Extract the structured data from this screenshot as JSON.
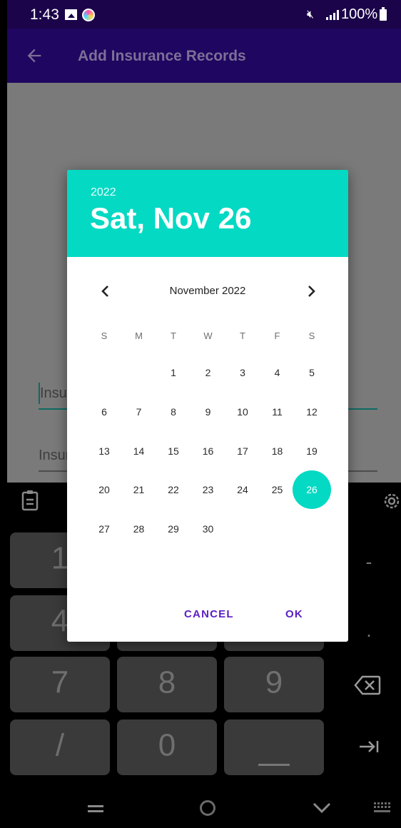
{
  "status_bar": {
    "time": "1:43",
    "battery_text": "100%"
  },
  "app_bar": {
    "title": "Add Insurance Records",
    "back_icon": "arrow-left-icon"
  },
  "form": {
    "field1_placeholder": "Insur",
    "field2_placeholder": "Insur"
  },
  "date_picker": {
    "header_year": "2022",
    "header_date": "Sat, Nov 26",
    "month_label": "November 2022",
    "weekdays": [
      "S",
      "M",
      "T",
      "W",
      "T",
      "F",
      "S"
    ],
    "days": [
      "1",
      "2",
      "3",
      "4",
      "5",
      "6",
      "7",
      "8",
      "9",
      "10",
      "11",
      "12",
      "13",
      "14",
      "15",
      "16",
      "17",
      "18",
      "19",
      "20",
      "21",
      "22",
      "23",
      "24",
      "25",
      "26",
      "27",
      "28",
      "29",
      "30"
    ],
    "first_weekday_index": 2,
    "selected_day": "26",
    "cancel_label": "CANCEL",
    "ok_label": "OK",
    "accent_color": "#04d9c3",
    "button_color": "#5a1fc4"
  },
  "keyboard": {
    "keys": {
      "k1": "1",
      "k4": "4",
      "k7": "7",
      "k8": "8",
      "k9": "9",
      "slash": "/",
      "k0": "0",
      "minus": "-",
      "dot": "."
    }
  }
}
